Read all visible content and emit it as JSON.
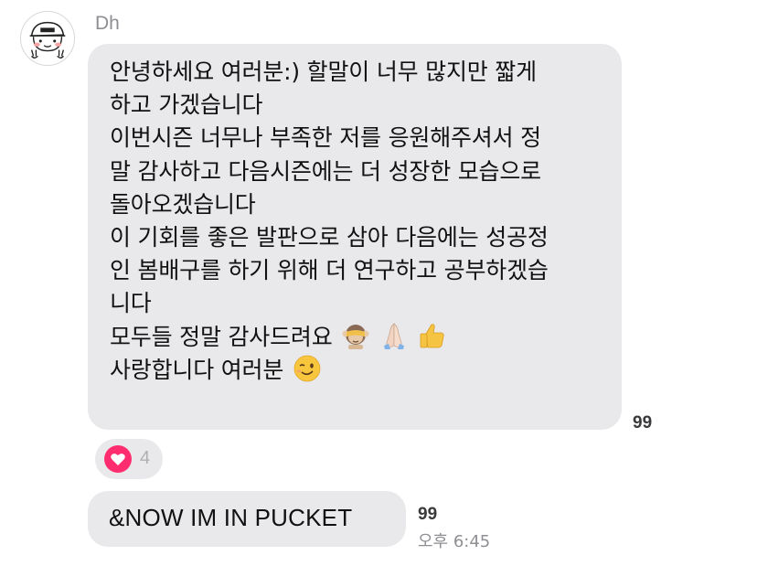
{
  "sender": {
    "name": "Dh",
    "avatar_icon": "cartoon-face-avatar-icon"
  },
  "message_main": {
    "lines": [
      "안녕하세요 여러분:) 할말이 너무 많지만 짧게",
      "하고 가겠습니다",
      "이번시즌 너무나 부족한 저를 응원해주셔서 정",
      "말 감사하고 다음시즌에는 더 성장한 모습으로",
      "돌아오겠습니다",
      "이 기회를 좋은 발판으로 삼아 다음에는 성공정",
      "인 봄배구를 하기 위해 더 연구하고 공부하겠습",
      "니다",
      "모두들 정말 감사드려요",
      "사랑합니다 여러분"
    ],
    "line9_emojis": [
      "see-no-evil-monkey-emoji",
      "folded-hands-emoji",
      "thumbs-up-emoji"
    ],
    "line10_emoji": "winking-face-emoji",
    "read_count": "99"
  },
  "reaction": {
    "icon": "heart-icon",
    "count": "4",
    "color": "#ff2d6f"
  },
  "message_second": {
    "text": "&NOW IM IN PUCKET",
    "read_count": "99",
    "timestamp": "오후 6:45"
  },
  "colors": {
    "bubble": "#e9e9eb",
    "meta_text": "#8e8e93"
  }
}
